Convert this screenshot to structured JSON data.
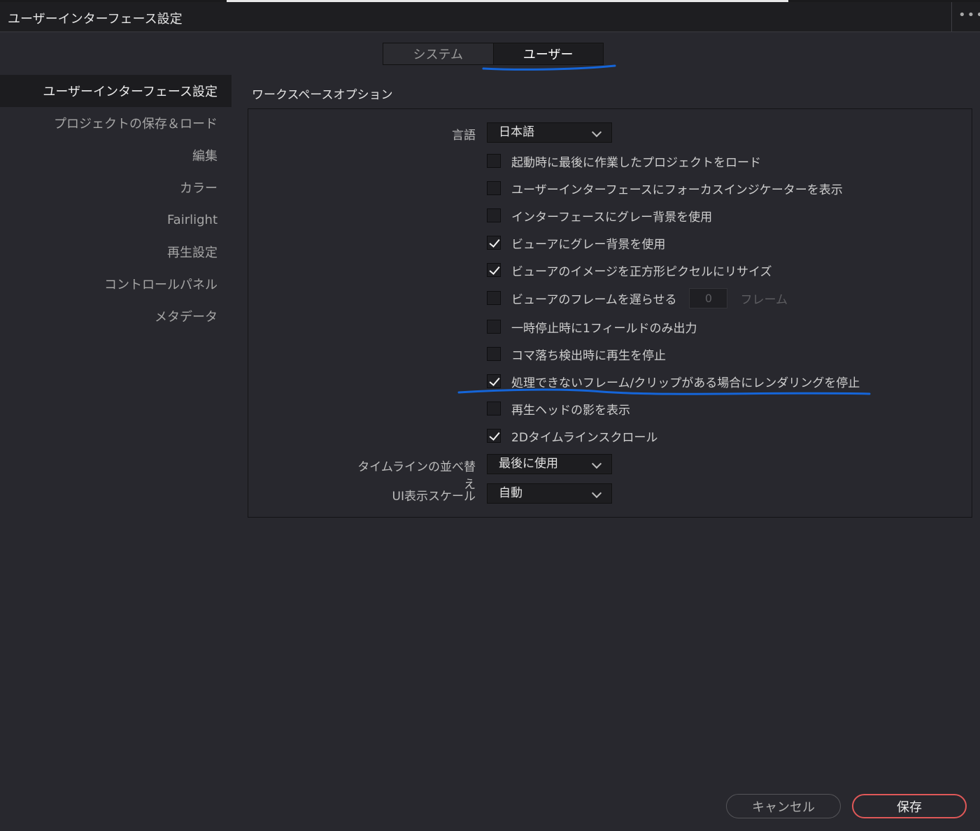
{
  "window": {
    "title": "ユーザーインターフェース設定",
    "more_glyph": "•••"
  },
  "tabs": [
    {
      "label": "システム",
      "active": false
    },
    {
      "label": "ユーザー",
      "active": true
    }
  ],
  "sidebar": {
    "items": [
      {
        "label": "ユーザーインターフェース設定",
        "active": true
      },
      {
        "label": "プロジェクトの保存＆ロード"
      },
      {
        "label": "編集"
      },
      {
        "label": "カラー"
      },
      {
        "label": "Fairlight"
      },
      {
        "label": "再生設定"
      },
      {
        "label": "コントロールパネル"
      },
      {
        "label": "メタデータ"
      }
    ]
  },
  "section_title": "ワークスペースオプション",
  "language": {
    "label": "言語",
    "value": "日本語"
  },
  "options": [
    {
      "label": "起動時に最後に作業したプロジェクトをロード",
      "checked": false
    },
    {
      "label": "ユーザーインターフェースにフォーカスインジケーターを表示",
      "checked": false
    },
    {
      "label": "インターフェースにグレー背景を使用",
      "checked": false
    },
    {
      "label": "ビューアにグレー背景を使用",
      "checked": true
    },
    {
      "label": "ビューアのイメージを正方形ピクセルにリサイズ",
      "checked": true
    },
    {
      "label": "ビューアのフレームを遅らせる",
      "checked": false,
      "input_value": "0",
      "suffix": "フレーム"
    },
    {
      "label": "一時停止時に1フィールドのみ出力",
      "checked": false
    },
    {
      "label": "コマ落ち検出時に再生を停止",
      "checked": false
    },
    {
      "label": "処理できないフレーム/クリップがある場合にレンダリングを停止",
      "checked": true
    },
    {
      "label": "再生ヘッドの影を表示",
      "checked": false
    },
    {
      "label": "2Dタイムラインスクロール",
      "checked": true
    }
  ],
  "timeline_sort": {
    "label": "タイムラインの並べ替え",
    "value": "最後に使用"
  },
  "ui_scale": {
    "label": "UI表示スケール",
    "value": "自動"
  },
  "buttons": {
    "cancel": "キャンセル",
    "save": "保存"
  },
  "colors": {
    "accent_red": "#e05858",
    "annotation_blue": "#1565d8"
  }
}
